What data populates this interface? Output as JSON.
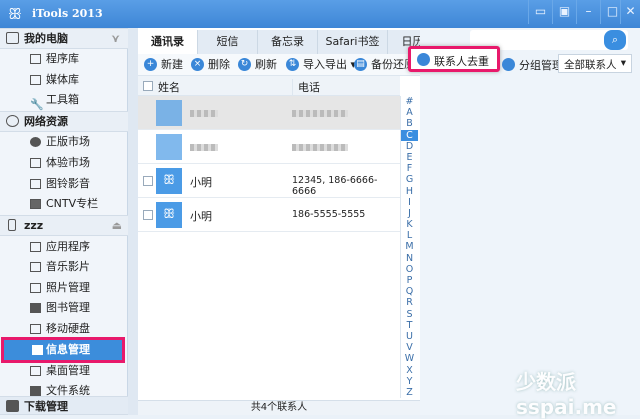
{
  "app": {
    "title": "iTools 2013"
  },
  "sidebar": {
    "my_pc": "我的电脑",
    "my_pc_items": [
      "程序库",
      "媒体库",
      "工具箱"
    ],
    "network": "网络资源",
    "network_items": [
      "正版市场",
      "体验市场",
      "图铃影音",
      "CNTV专栏"
    ],
    "device": "zzz",
    "device_items": [
      "应用程序",
      "音乐影片",
      "照片管理",
      "图书管理",
      "移动硬盘",
      "信息管理",
      "桌面管理",
      "文件系统"
    ],
    "download": "下载管理"
  },
  "tabs": [
    "通讯录",
    "短信",
    "备忘录",
    "Safari书签",
    "日历"
  ],
  "toolbar": {
    "new": "新建",
    "delete": "删除",
    "refresh": "刷新",
    "import_export": "导入导出",
    "backup": "备份还原",
    "dedupe": "联系人去重",
    "group": "分组管理",
    "filter": "全部联系人"
  },
  "table": {
    "col_name": "姓名",
    "col_phone": "电话",
    "rows": [
      {
        "name": "小明",
        "phone": "12345, 186-6666-6666"
      },
      {
        "name": "小明",
        "phone": "186-5555-5555"
      }
    ]
  },
  "alphabet": [
    "#",
    "A",
    "B",
    "C",
    "D",
    "E",
    "F",
    "G",
    "H",
    "I",
    "J",
    "K",
    "L",
    "M",
    "N",
    "O",
    "P",
    "Q",
    "R",
    "S",
    "T",
    "U",
    "V",
    "W",
    "X",
    "Y",
    "Z"
  ],
  "status": "共4个联系人",
  "watermark": "少数派 sspai.me",
  "colors": {
    "accent": "#3c8ddb",
    "highlight": "#e8196b"
  }
}
